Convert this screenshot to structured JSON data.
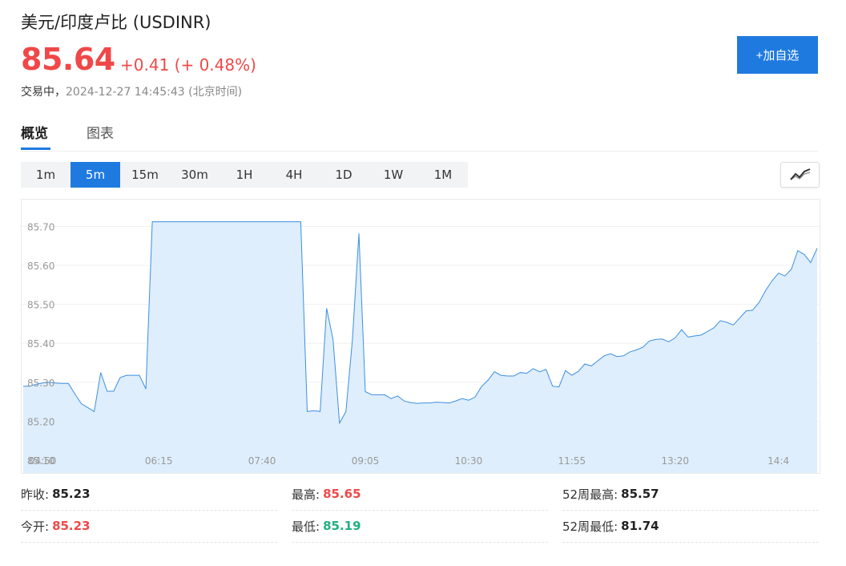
{
  "header": {
    "title": "美元/印度卢比 (USDINR)",
    "price": "85.64",
    "change": "+0.41 (+ 0.48%)",
    "status_label": "交易中，",
    "datetime": "2024-12-27 14:45:43 (北京时间)",
    "add_button": "+加自选"
  },
  "tabs": [
    {
      "label": "概览",
      "active": true
    },
    {
      "label": "图表",
      "active": false
    }
  ],
  "ranges": [
    {
      "label": "1m",
      "active": false
    },
    {
      "label": "5m",
      "active": true
    },
    {
      "label": "15m",
      "active": false
    },
    {
      "label": "30m",
      "active": false
    },
    {
      "label": "1H",
      "active": false
    },
    {
      "label": "4H",
      "active": false
    },
    {
      "label": "1D",
      "active": false
    },
    {
      "label": "1W",
      "active": false
    },
    {
      "label": "1M",
      "active": false
    }
  ],
  "colors": {
    "accent": "#1f7ae0",
    "up": "#f04848",
    "down": "#20b080",
    "line": "#3d8fe0",
    "area": "#deeefc"
  },
  "stats": {
    "prev_close_label": "昨收:",
    "prev_close": "85.23",
    "open_label": "今开:",
    "open": "85.23",
    "high_label": "最高:",
    "high": "85.65",
    "low_label": "最低:",
    "low": "85.19",
    "w52_high_label": "52周最高:",
    "w52_high": "85.57",
    "w52_low_label": "52周最低:",
    "w52_low": "81.74"
  },
  "chart_data": {
    "type": "area",
    "interval": "5m",
    "ylim": [
      85.1,
      85.74
    ],
    "y_ticks": [
      "85.70",
      "85.60",
      "85.50",
      "85.40",
      "85.30",
      "85.20",
      "85.10"
    ],
    "x_ticks": [
      {
        "index": 3,
        "label": "04:50"
      },
      {
        "index": 21,
        "label": "06:15"
      },
      {
        "index": 37,
        "label": "07:40"
      },
      {
        "index": 53,
        "label": "09:05"
      },
      {
        "index": 69,
        "label": "10:30"
      },
      {
        "index": 85,
        "label": "11:55"
      },
      {
        "index": 101,
        "label": "13:20"
      },
      {
        "index": 117,
        "label": "14:4"
      }
    ],
    "grid": true,
    "values": [
      85.29,
      85.29,
      85.295,
      85.298,
      85.3,
      85.298,
      85.297,
      85.297,
      85.27,
      85.245,
      85.235,
      85.225,
      85.325,
      85.277,
      85.277,
      85.312,
      85.318,
      85.318,
      85.318,
      85.283,
      85.712,
      85.712,
      85.712,
      85.712,
      85.712,
      85.712,
      85.712,
      85.712,
      85.712,
      85.712,
      85.712,
      85.712,
      85.712,
      85.712,
      85.712,
      85.712,
      85.712,
      85.712,
      85.712,
      85.712,
      85.712,
      85.712,
      85.712,
      85.712,
      85.225,
      85.227,
      85.225,
      85.49,
      85.41,
      85.195,
      85.225,
      85.41,
      85.682,
      85.276,
      85.268,
      85.268,
      85.268,
      85.258,
      85.265,
      85.252,
      85.248,
      85.246,
      85.247,
      85.247,
      85.249,
      85.248,
      85.247,
      85.252,
      85.258,
      85.254,
      85.262,
      85.289,
      85.305,
      85.327,
      85.318,
      85.316,
      85.316,
      85.325,
      85.323,
      85.335,
      85.327,
      85.333,
      85.29,
      85.288,
      85.33,
      85.318,
      85.328,
      85.347,
      85.342,
      85.355,
      85.368,
      85.373,
      85.366,
      85.368,
      85.378,
      85.383,
      85.39,
      85.406,
      85.41,
      85.411,
      85.404,
      85.414,
      85.435,
      85.416,
      85.419,
      85.421,
      85.43,
      85.44,
      85.458,
      85.454,
      85.447,
      85.465,
      85.483,
      85.485,
      85.505,
      85.535,
      85.56,
      85.58,
      85.573,
      85.59,
      85.638,
      85.628,
      85.607,
      85.644
    ]
  }
}
